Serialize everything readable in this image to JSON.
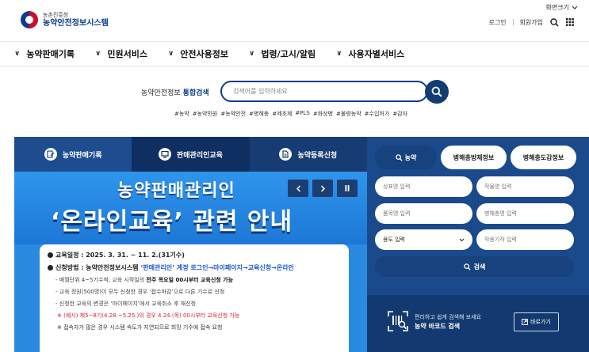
{
  "header": {
    "logo_org": "농촌진흥청",
    "logo_name": "농약안전정보시스템",
    "font_size_label": "화면크기",
    "login": "로그인",
    "signup": "회원가입"
  },
  "nav": {
    "items": [
      {
        "label": "농약판매기록"
      },
      {
        "label": "민원서비스"
      },
      {
        "label": "안전사용정보"
      },
      {
        "label": "법령/고시/알림"
      },
      {
        "label": "사용자별서비스"
      }
    ]
  },
  "search": {
    "label_prefix": "농약안전정보",
    "label_highlight": "통합검색",
    "placeholder": "검색어를 입력하세요",
    "value": "",
    "hashtags": [
      "#농약",
      "#농약민원",
      "#농약안전",
      "#병해충",
      "#제초제",
      "#PLS",
      "#화상병",
      "#불량농약",
      "#수입허가",
      "#감자"
    ]
  },
  "tabs": [
    {
      "label": "농약판매기록"
    },
    {
      "label": "판매관리인교육"
    },
    {
      "label": "농약등록신청"
    }
  ],
  "banner": {
    "title_line1": "농약판매관리인",
    "title_line2": "‘온라인교육’ 관련 안내",
    "edu_period": "교육일정 : 2025. 3. 31. ~ 11. 2.(31기수)",
    "apply_prefix": "신청방법 : 농약안전정보시스템 ",
    "apply_path": "‘판매관리인’ 계정 로그인→마이페이지→교육신청→온라인",
    "sub1_prefix": "- 매월단위 4~5기수씩, 교육 시작일의 ",
    "sub1_bold": "전주 목요일 00시부터 교육신청 가능",
    "sub2": "- 교육 정원(500명)이 모두 신청한 경우 ‘접수마감’으로 다른 기수로 신청",
    "sub3": "- 신청한 교육의 변경은 ‘마이페이지’에서 교육취소 후 재신청",
    "red_note": "※ (예시) 제5~8기(4.28.~5.25.)의 경우 4.24.(목) 00시부터 교육신청 가능",
    "access_note": "※ 접속자가 많은 경우 시스템 속도가 지연되므로 희망 기수에 접속 요청"
  },
  "panel": {
    "tabs": [
      {
        "label": "농약",
        "active": true
      },
      {
        "label": "병해충방제정보",
        "active": false
      },
      {
        "label": "병해충도감정보",
        "active": false
      }
    ],
    "fields": {
      "brand_placeholder": "상표명 입력",
      "crop_placeholder": "작물명 입력",
      "item_placeholder": "품목명 입력",
      "pest_placeholder": "병해충명 입력",
      "usage_select": "용도 입력",
      "mechanism_placeholder": "작용기작 입력"
    },
    "search_label": "검색",
    "barcode_small": "편리하고 쉽게 검색해 보세요",
    "barcode_big": "농약 바코드 검색",
    "shortcut_label": "바로가기"
  },
  "colors": {
    "primary": "#0b3c8c",
    "panel": "#1a4a8c",
    "banner": "#2a8ae0",
    "accent_red": "#d61f2c"
  }
}
